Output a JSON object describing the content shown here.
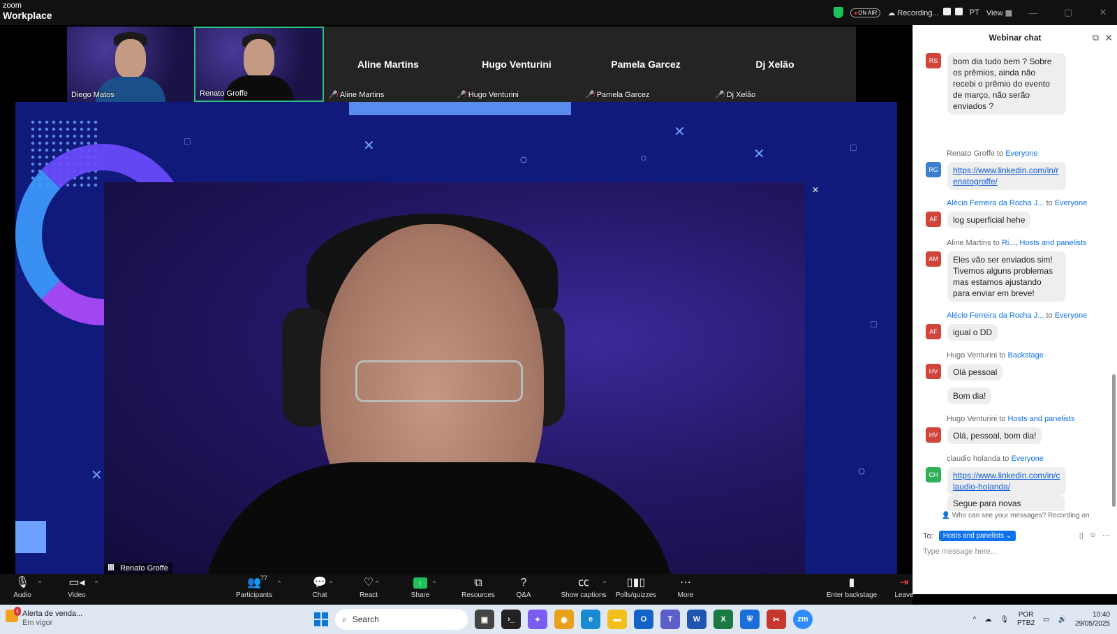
{
  "window": {
    "brand_small": "zoom",
    "brand_large": "Workplace",
    "on_air": "ON AIR",
    "recording": "Recording...",
    "language": "PT",
    "view": "View"
  },
  "gallery": [
    {
      "name": "Diego Matos",
      "type": "video"
    },
    {
      "name": "Renato Groffe",
      "type": "video",
      "active": true
    },
    {
      "name": "Aline Martins",
      "type": "name"
    },
    {
      "name": "Hugo Venturini",
      "type": "name"
    },
    {
      "name": "Pamela Garcez",
      "type": "name"
    },
    {
      "name": "Dj Xelão",
      "type": "name"
    }
  ],
  "main_video": {
    "speaker": "Renato Groffe"
  },
  "chat": {
    "title": "Webinar chat",
    "notice": "Who can see your messages? Recording on",
    "to_label": "To:",
    "to_value": "Hosts and panelists",
    "placeholder": "Type message here...",
    "messages": [
      {
        "initials": "RS",
        "color": "#d0453a",
        "sender": "",
        "to": "",
        "target": "",
        "text": "bom dia tudo bem ? Sobre os prêmios, ainda não recebi o prêmio do evento de março, não serão enviados ?"
      },
      {
        "initials": "RG",
        "color": "#3a7fd0",
        "sender": "Renato Groffe",
        "to": "to",
        "target": "Everyone",
        "text": "https://www.linkedin.com/in/renatogroffe/",
        "link": true
      },
      {
        "initials": "AF",
        "color": "#d0453a",
        "sender": "Alécio Ferreira da Rocha J...",
        "to": "to",
        "target": "Everyone",
        "text": "log superficial hehe",
        "sender_blue": true
      },
      {
        "initials": "AM",
        "color": "#d0453a",
        "sender": "Aline Martins",
        "to": "to",
        "target": "Ri..., Hosts and panelists",
        "text": "Eles vão ser enviados sim! Tivemos alguns problemas mas estamos ajustando para enviar em breve!"
      },
      {
        "initials": "AF",
        "color": "#d0453a",
        "sender": "Alécio Ferreira da Rocha J...",
        "to": "to",
        "target": "Everyone",
        "text": "igual o DD",
        "sender_blue": true
      },
      {
        "initials": "HV",
        "color": "#d0453a",
        "sender": "Hugo Venturini",
        "to": "to",
        "target": "Backstage",
        "text": "Olá pessoal",
        "extra": "Bom dia!"
      },
      {
        "initials": "HV",
        "color": "#d0453a",
        "sender": "Hugo Venturini",
        "to": "to",
        "target": "Hosts and panelists",
        "text": "Olá, pessoal, bom dia!"
      },
      {
        "initials": "CH",
        "color": "#2fb15a",
        "sender": "claudio holanda",
        "to": "to",
        "target": "Everyone",
        "text": "https://www.linkedin.com/in/claudio-holanda/",
        "link": true,
        "extra": "Segue para novas conexões."
      }
    ]
  },
  "toolbar": {
    "audio": "Audio",
    "video": "Video",
    "participants": "Participants",
    "participants_count": "77",
    "chat": "Chat",
    "react": "React",
    "share": "Share",
    "resources": "Resources",
    "qa": "Q&A",
    "captions": "Show captions",
    "polls": "Polls/quizzes",
    "more": "More",
    "backstage": "Enter backstage",
    "leave": "Leave"
  },
  "taskbar": {
    "alert_title": "Alerta de venda...",
    "alert_sub": "Em vigor",
    "alert_badge": "4",
    "search": "Search",
    "lang_top": "POR",
    "lang_bottom": "PTB2",
    "time": "10:40",
    "date": "29/05/2025"
  }
}
